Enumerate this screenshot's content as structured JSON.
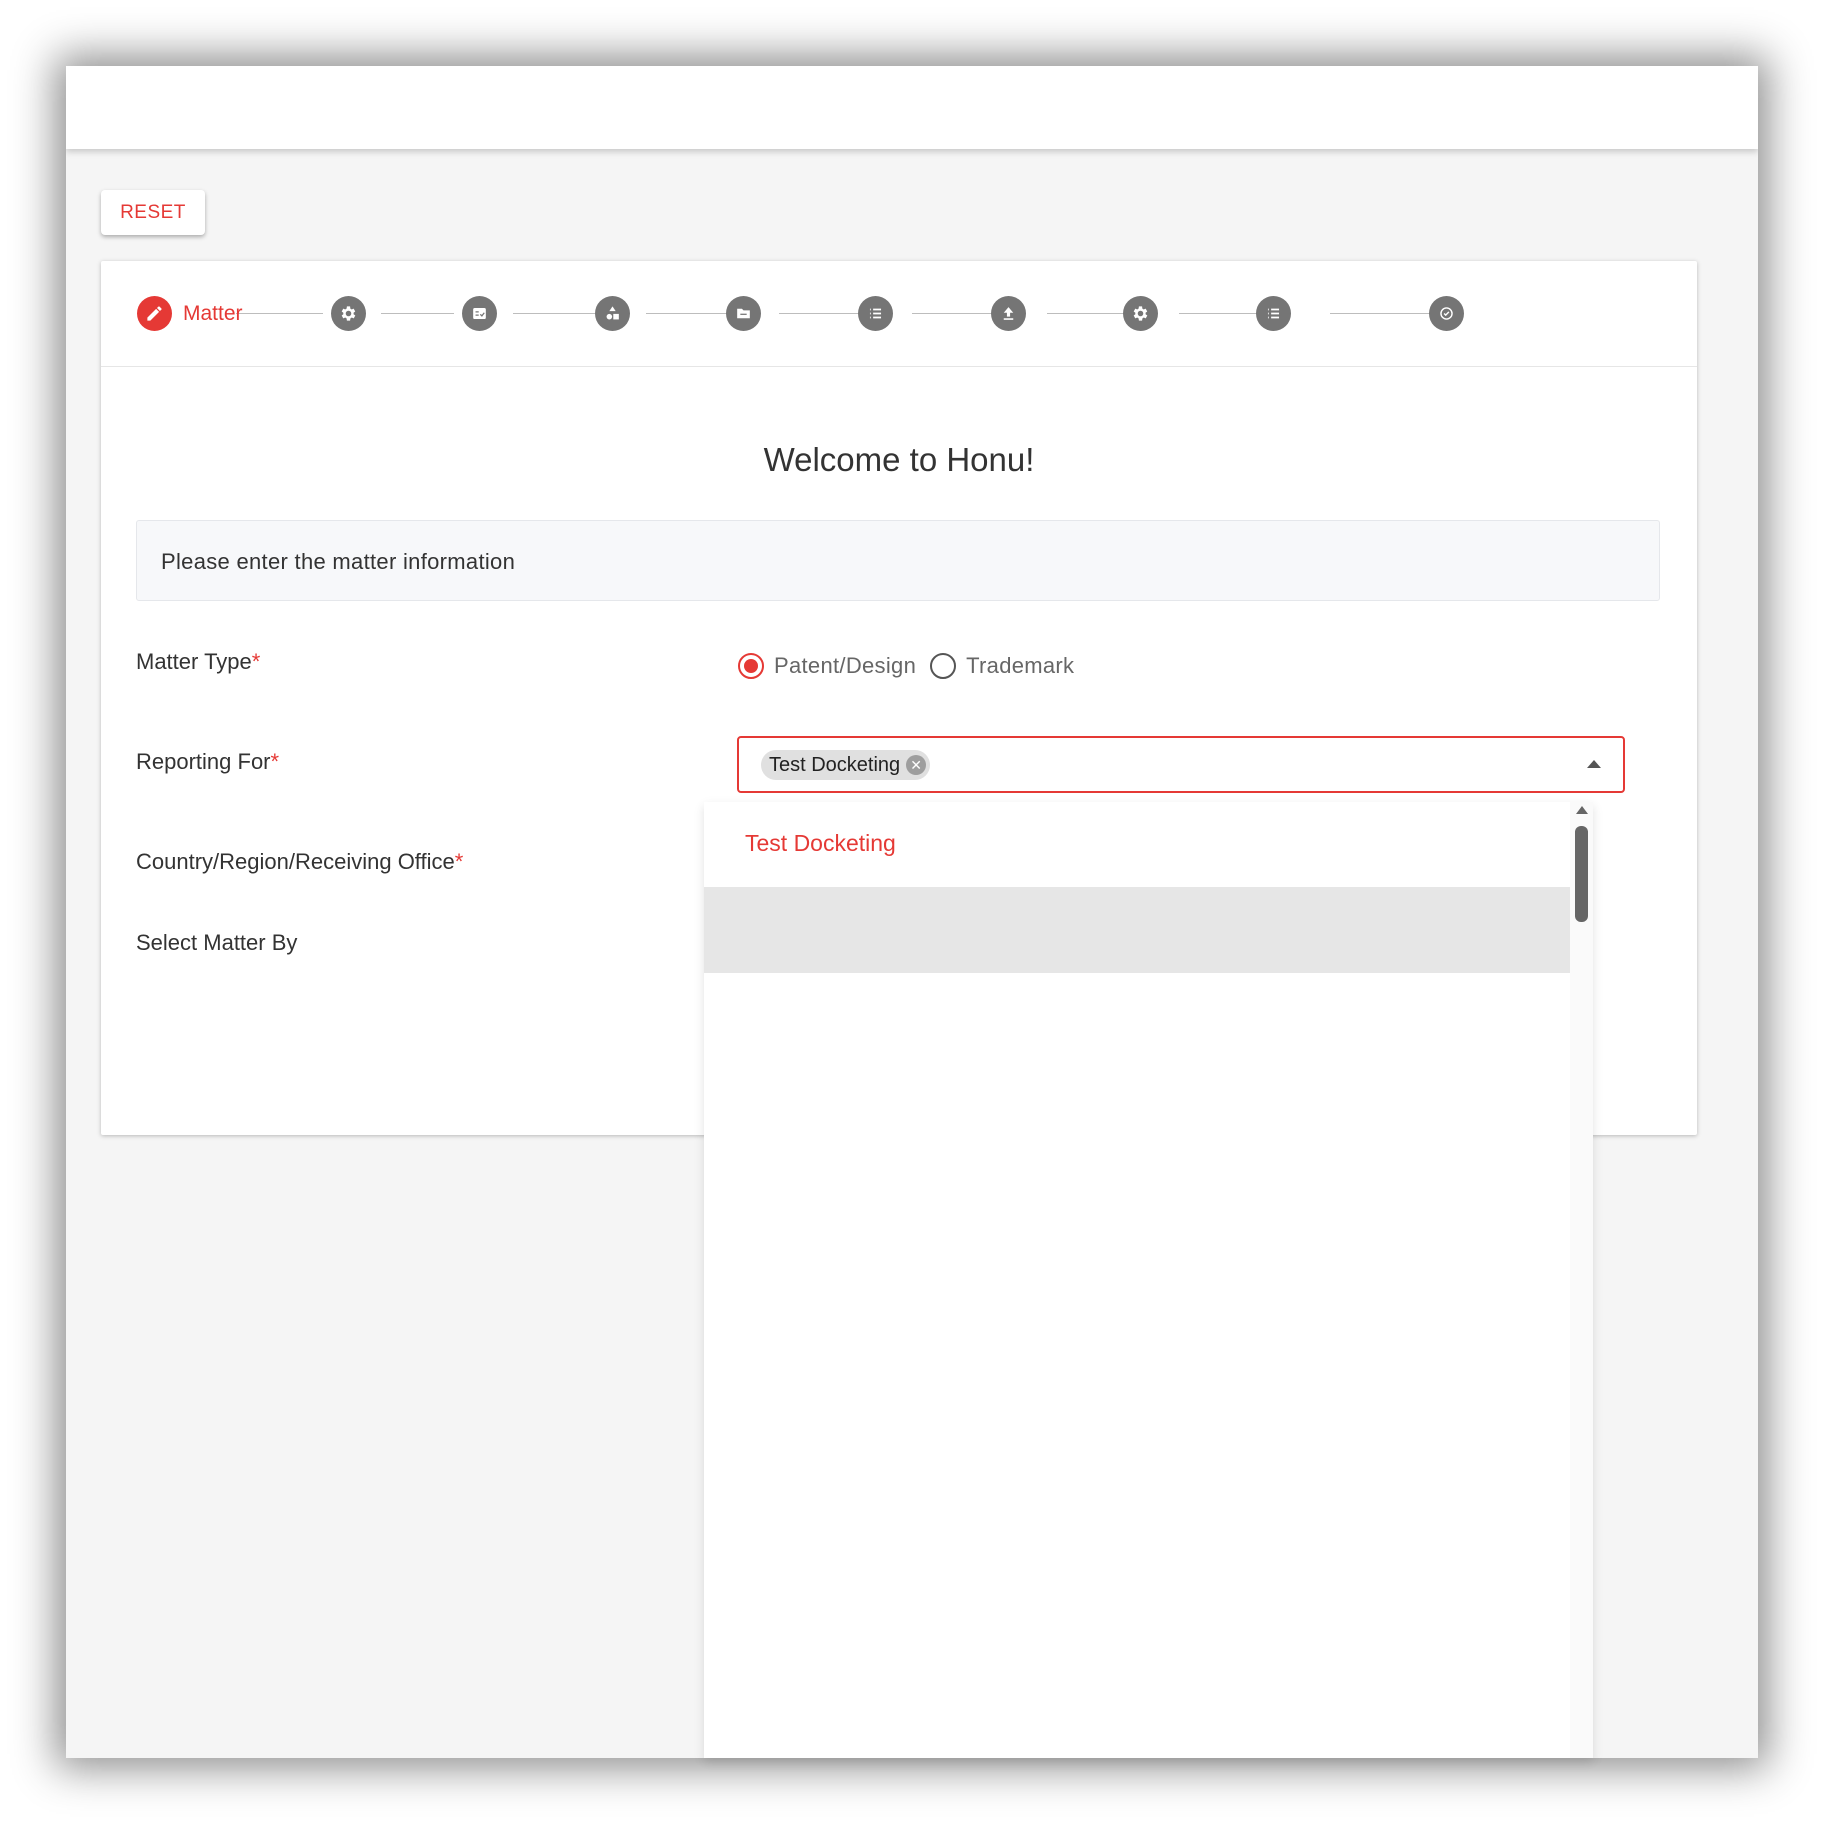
{
  "toolbar": {
    "reset_label": "RESET"
  },
  "stepper": {
    "active_label": "Matter",
    "steps": [
      {
        "icon": "pencil-icon"
      },
      {
        "icon": "gear-icon"
      },
      {
        "icon": "checklist-icon"
      },
      {
        "icon": "shapes-icon"
      },
      {
        "icon": "folder-icon"
      },
      {
        "icon": "list-icon"
      },
      {
        "icon": "upload-icon"
      },
      {
        "icon": "gear-icon"
      },
      {
        "icon": "list-icon"
      },
      {
        "icon": "check-circle-icon"
      }
    ]
  },
  "main": {
    "welcome": "Welcome to Honu!",
    "info": "Please enter the matter information",
    "matter_type": {
      "label": "Matter Type",
      "options": [
        "Patent/Design",
        "Trademark"
      ],
      "selected": "Patent/Design"
    },
    "reporting_for": {
      "label": "Reporting For",
      "chip": "Test Docketing",
      "dropdown_option": "Test Docketing"
    },
    "country_label": "Country/Region/Receiving Office",
    "select_matter_label": "Select Matter By",
    "required_mark": "*"
  },
  "colors": {
    "accent": "#e53935",
    "step_inactive": "#757575"
  }
}
